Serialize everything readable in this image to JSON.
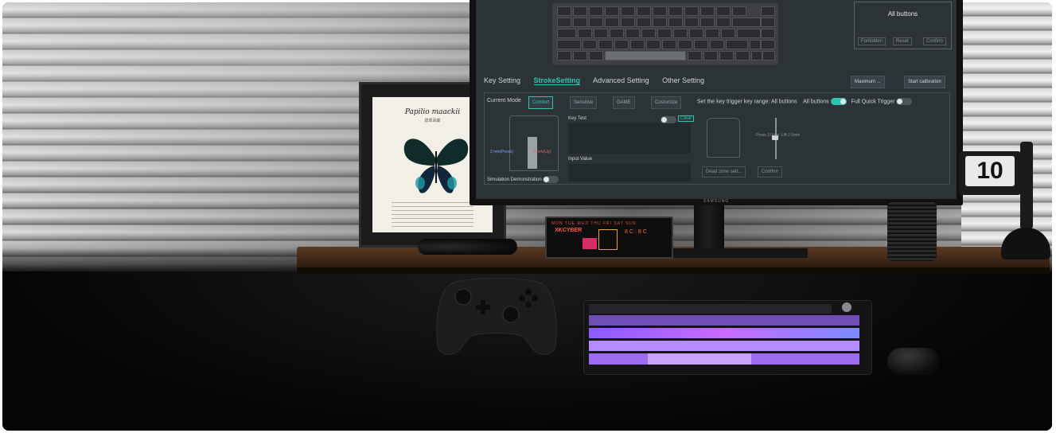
{
  "frame": {
    "title": "Papilio maackii",
    "subtitle": "碧翠凤蝶"
  },
  "monitor": {
    "brand": "SAMSUNG",
    "panel": {
      "title": "All buttons",
      "forbidden": "Forbidden",
      "reset": "Reset",
      "confirm": "Confirm"
    },
    "tabs": {
      "key_setting": "Key Setting",
      "stroke_setting": "StrokeSetting",
      "advanced_setting": "Advanced Setting",
      "other_setting": "Other Setting"
    },
    "maximum": "Maximum ...",
    "start_calibration": "Start calibration",
    "current_mode_label": "Current Mode",
    "modes": [
      "Comfort",
      "Sensitive",
      "GAME",
      "Customize"
    ],
    "range_label": "Set the key trigger key range: All buttons",
    "all_buttons": "All buttons",
    "full_quick_trigger": "Full Quick Trigger",
    "key_test": "Key Test",
    "clear": "Clear",
    "input_value": "Input Value",
    "simulation": "Simulation Demonstration",
    "press_left": "2 mm(Press)",
    "press_right": "2 mm(Up)",
    "dead_zone": "Dead zone sett...",
    "confirm": "Confirm",
    "press_label": "Press 2.0mm",
    "lift_label": "Lift 2.0mm"
  },
  "display": {
    "days": "MON  TUE  WED  THU  FRI  SAT  SUN",
    "big": "XKCYBER",
    "right": "8C:8C"
  },
  "clock": {
    "digit": "10"
  },
  "colors": {
    "accent": "#2fc4b2",
    "screen_bg": "#2b3336",
    "keyboard_rgb": "#b46cff"
  }
}
